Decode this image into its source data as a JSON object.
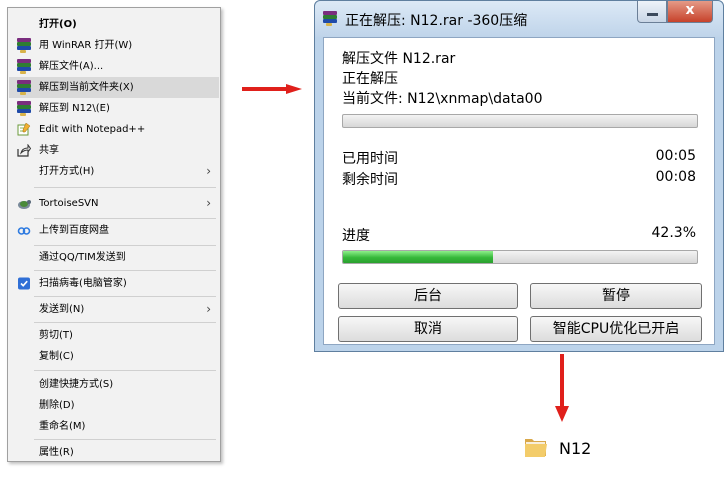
{
  "context_menu": {
    "items": [
      {
        "label": "打开(O)"
      },
      {
        "label": "用 WinRAR 打开(W)"
      },
      {
        "label": "解压文件(A)..."
      },
      {
        "label": "解压到当前文件夹(X)"
      },
      {
        "label": "解压到 N12\\(E)"
      },
      {
        "label": "Edit with Notepad++"
      },
      {
        "label": "共享"
      },
      {
        "label": "打开方式(H)"
      },
      {
        "label": "TortoiseSVN"
      },
      {
        "label": "上传到百度网盘"
      },
      {
        "label": "通过QQ/TIM发送到"
      },
      {
        "label": "扫描病毒(电脑管家)"
      },
      {
        "label": "发送到(N)"
      },
      {
        "label": "剪切(T)"
      },
      {
        "label": "复制(C)"
      },
      {
        "label": "创建快捷方式(S)"
      },
      {
        "label": "删除(D)"
      },
      {
        "label": "重命名(M)"
      },
      {
        "label": "属性(R)"
      }
    ],
    "highlighted_item": "解压到当前文件夹(X)"
  },
  "dialog": {
    "title": "正在解压: N12.rar -360压缩",
    "file_line": "解压文件 N12.rar",
    "status": "正在解压",
    "current_file_line": "当前文件: N12\\xnmap\\data00",
    "current_file_progress": 0,
    "elapsed_label": "已用时间",
    "elapsed_value": "00:05",
    "remaining_label": "剩余时间",
    "remaining_value": "00:08",
    "progress_label": "进度",
    "progress_text": "42.3%",
    "progress_value": 42.3,
    "buttons": {
      "background": "后台",
      "pause": "暂停",
      "cancel": "取消",
      "cpu_opt": "智能CPU优化已开启"
    },
    "window_controls": {
      "minimize": "—",
      "close": "x"
    }
  },
  "result": {
    "folder_name": "N12"
  },
  "colors": {
    "arrow": "#e0201b",
    "progress_fill": "#36b83a",
    "menu_bg": "#f2f2f2",
    "menu_highlight": "#d9d9d9"
  }
}
